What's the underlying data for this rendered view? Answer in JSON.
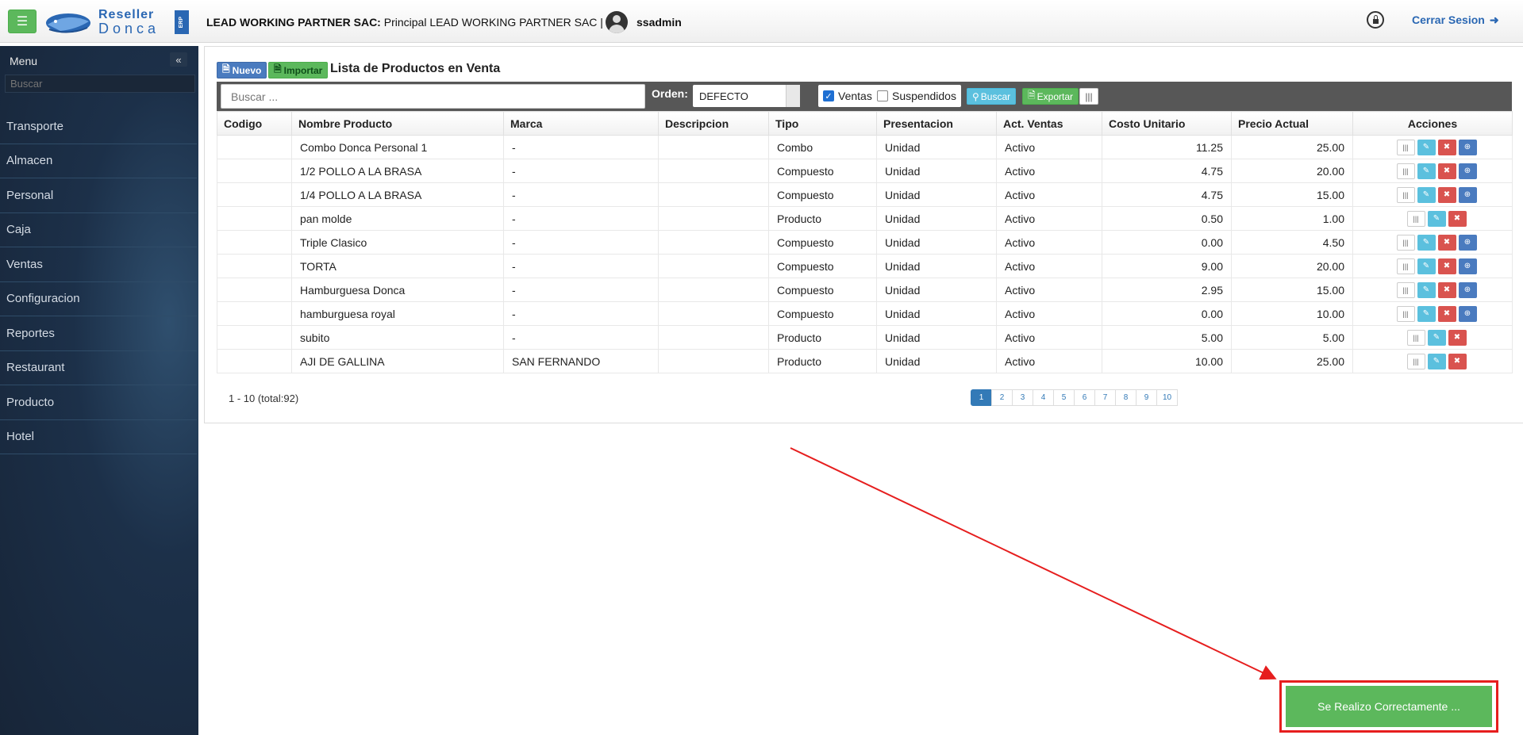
{
  "header": {
    "company_bold": "LEAD WORKING PARTNER SAC:",
    "company_rest": " Principal LEAD WORKING PARTNER SAC |",
    "username": "ssadmin",
    "logout_label": "Cerrar Sesion",
    "logo": {
      "word1": "Reseller",
      "word2": "Donca",
      "badge": "ERP"
    }
  },
  "sidebar": {
    "title": "Menu",
    "search_placeholder": "Buscar",
    "items": [
      {
        "label": "Transporte"
      },
      {
        "label": "Almacen"
      },
      {
        "label": "Personal"
      },
      {
        "label": "Caja"
      },
      {
        "label": "Ventas"
      },
      {
        "label": "Configuracion"
      },
      {
        "label": "Reportes"
      },
      {
        "label": "Restaurant"
      },
      {
        "label": "Producto"
      },
      {
        "label": "Hotel"
      }
    ]
  },
  "panel": {
    "nuevo_label": "Nuevo",
    "importar_label": "Importar",
    "title": "Lista de Productos en Venta"
  },
  "toolbar": {
    "search_placeholder": "Buscar ...",
    "orden_label": "Orden:",
    "orden_value": "DEFECTO",
    "ventas_label": "Ventas",
    "ventas_checked": true,
    "suspendidos_label": "Suspendidos",
    "suspendidos_checked": false,
    "buscar_label": "Buscar",
    "exportar_label": "Exportar"
  },
  "table": {
    "columns": [
      "Codigo",
      "Nombre Producto",
      "Marca",
      "Descripcion",
      "Tipo",
      "Presentacion",
      "Act. Ventas",
      "Costo Unitario",
      "Precio Actual",
      "Acciones"
    ],
    "rows": [
      {
        "codigo": "",
        "nombre": "Combo Donca Personal 1",
        "marca": "-",
        "descripcion": "",
        "tipo": "Combo",
        "presentacion": "Unidad",
        "estado": "Activo",
        "costo": "11.25",
        "precio": "25.00"
      },
      {
        "codigo": "",
        "nombre": "1/2 POLLO A LA BRASA",
        "marca": "-",
        "descripcion": "",
        "tipo": "Compuesto",
        "presentacion": "Unidad",
        "estado": "Activo",
        "costo": "4.75",
        "precio": "20.00"
      },
      {
        "codigo": "",
        "nombre": "1/4 POLLO A LA BRASA",
        "marca": "-",
        "descripcion": "",
        "tipo": "Compuesto",
        "presentacion": "Unidad",
        "estado": "Activo",
        "costo": "4.75",
        "precio": "15.00"
      },
      {
        "codigo": "",
        "nombre": "pan molde",
        "marca": "-",
        "descripcion": "",
        "tipo": "Producto",
        "presentacion": "Unidad",
        "estado": "Activo",
        "costo": "0.50",
        "precio": "1.00"
      },
      {
        "codigo": "",
        "nombre": "Triple Clasico",
        "marca": "-",
        "descripcion": "",
        "tipo": "Compuesto",
        "presentacion": "Unidad",
        "estado": "Activo",
        "costo": "0.00",
        "precio": "4.50"
      },
      {
        "codigo": "",
        "nombre": "TORTA",
        "marca": "-",
        "descripcion": "",
        "tipo": "Compuesto",
        "presentacion": "Unidad",
        "estado": "Activo",
        "costo": "9.00",
        "precio": "20.00"
      },
      {
        "codigo": "",
        "nombre": "Hamburguesa Donca",
        "marca": "-",
        "descripcion": "",
        "tipo": "Compuesto",
        "presentacion": "Unidad",
        "estado": "Activo",
        "costo": "2.95",
        "precio": "15.00"
      },
      {
        "codigo": "",
        "nombre": "hamburguesa royal",
        "marca": "-",
        "descripcion": "",
        "tipo": "Compuesto",
        "presentacion": "Unidad",
        "estado": "Activo",
        "costo": "0.00",
        "precio": "10.00"
      },
      {
        "codigo": "",
        "nombre": "subito",
        "marca": "-",
        "descripcion": "",
        "tipo": "Producto",
        "presentacion": "Unidad",
        "estado": "Activo",
        "costo": "5.00",
        "precio": "5.00"
      },
      {
        "codigo": "",
        "nombre": "AJI DE GALLINA",
        "marca": "SAN FERNANDO",
        "descripcion": "",
        "tipo": "Producto",
        "presentacion": "Unidad",
        "estado": "Activo",
        "costo": "10.00",
        "precio": "25.00"
      }
    ]
  },
  "pagination": {
    "info": "1 - 10 (total:92)",
    "pages": [
      "1",
      "2",
      "3",
      "4",
      "5",
      "6",
      "7",
      "8",
      "9",
      "10"
    ],
    "active_page": "1"
  },
  "toast": {
    "message": "Se Realizo Correctamente ..."
  },
  "colors": {
    "accent": "#337ab7",
    "success": "#5cb85c",
    "danger": "#d9534f",
    "annotation": "#e61e1e"
  }
}
